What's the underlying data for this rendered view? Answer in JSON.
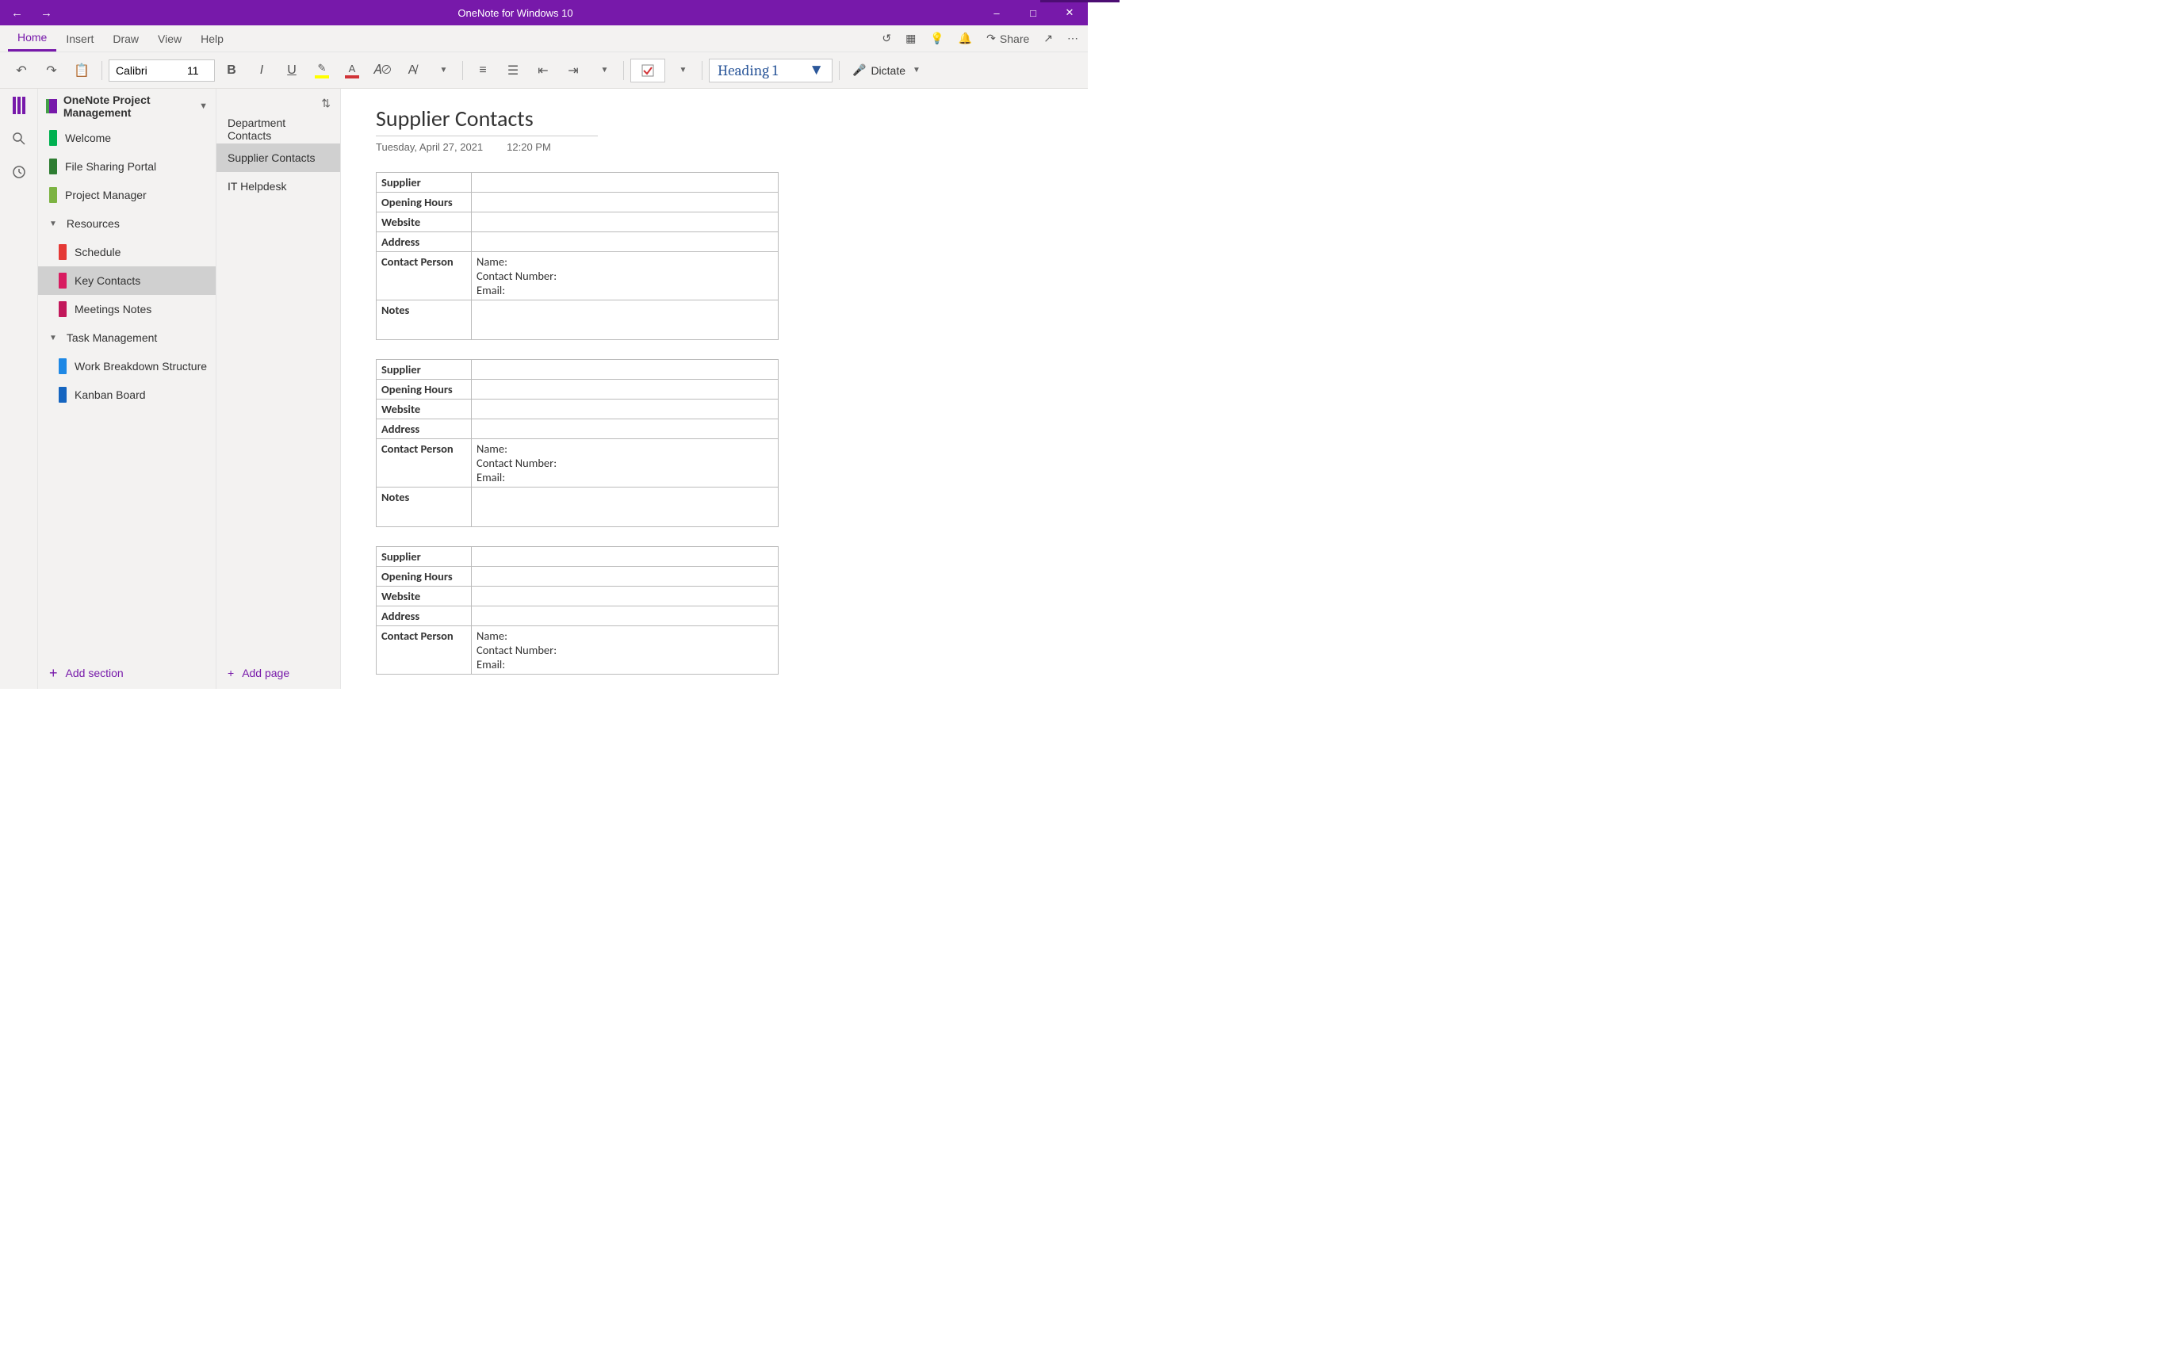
{
  "titlebar": {
    "title": "OneNote for Windows 10"
  },
  "tabs": {
    "home": "Home",
    "insert": "Insert",
    "draw": "Draw",
    "view": "View",
    "help": "Help",
    "share": "Share"
  },
  "toolbar": {
    "font_name": "Calibri",
    "font_size": "11",
    "style": "Heading 1",
    "dictate": "Dictate"
  },
  "notebook": {
    "name": "OneNote Project Management",
    "sections": [
      {
        "label": "Welcome",
        "color": "#00b050"
      },
      {
        "label": "File Sharing Portal",
        "color": "#2e7d32"
      },
      {
        "label": "Project Manager",
        "color": "#7cb342"
      }
    ],
    "group1": {
      "label": "Resources",
      "items": [
        {
          "label": "Schedule",
          "color": "#e53935"
        },
        {
          "label": "Key Contacts",
          "color": "#d81b60",
          "selected": true
        },
        {
          "label": "Meetings Notes",
          "color": "#c2185b"
        }
      ]
    },
    "group2": {
      "label": "Task Management",
      "items": [
        {
          "label": "Work Breakdown Structure",
          "color": "#1e88e5"
        },
        {
          "label": "Kanban Board",
          "color": "#1565c0"
        }
      ]
    },
    "add_section": "Add section"
  },
  "pages": {
    "items": [
      {
        "label": "Department Contacts"
      },
      {
        "label": "Supplier Contacts",
        "selected": true
      },
      {
        "label": "IT Helpdesk"
      }
    ],
    "add_page": "Add page"
  },
  "page": {
    "title": "Supplier Contacts",
    "date": "Tuesday, April 27, 2021",
    "time": "12:20 PM",
    "table_labels": {
      "supplier": "Supplier",
      "hours": "Opening Hours",
      "website": "Website",
      "address": "Address",
      "contact": "Contact Person",
      "notes": "Notes",
      "name": "Name:",
      "number": "Contact Number:",
      "email": "Email:"
    }
  }
}
